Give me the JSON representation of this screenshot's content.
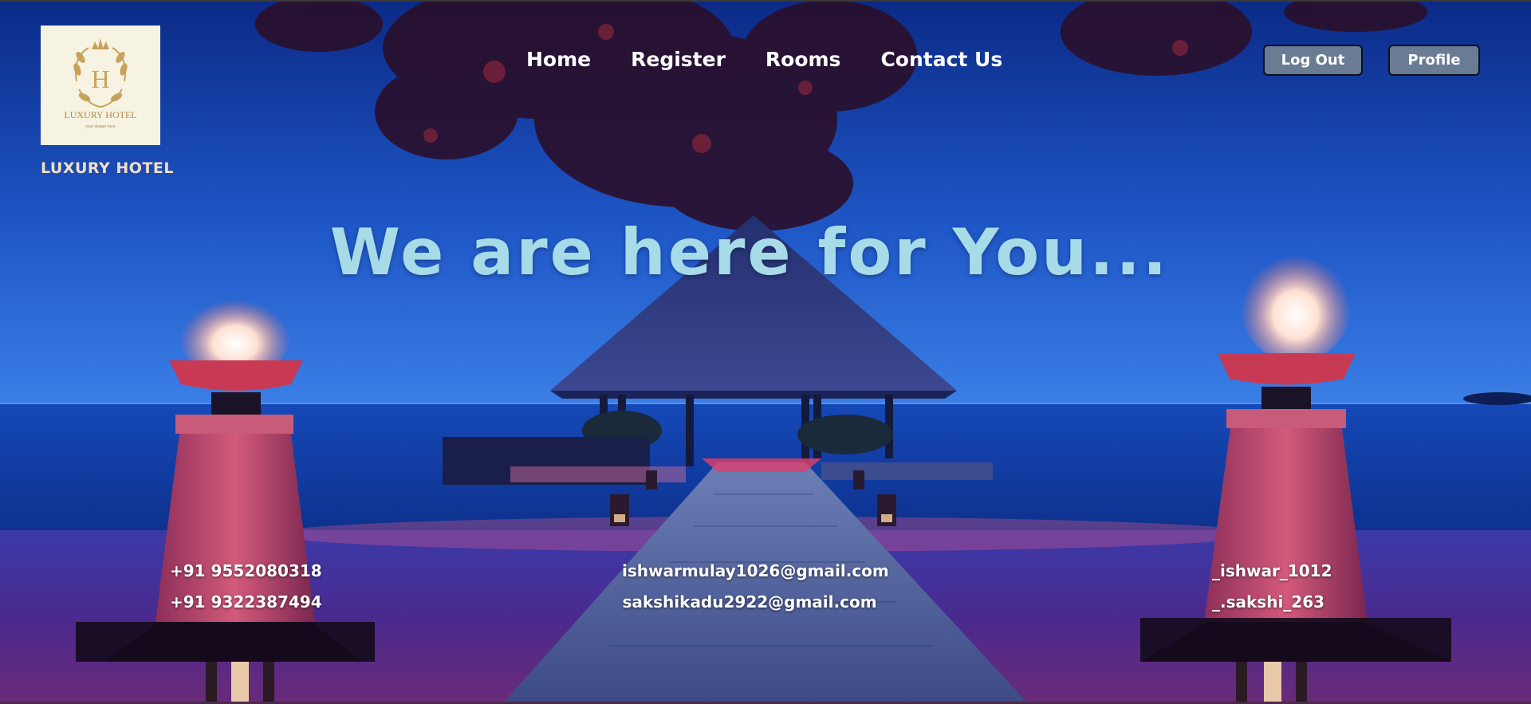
{
  "brand": {
    "logo_title": "LUXURY HOTEL",
    "logo_initial": "H",
    "logo_tagline": "your slogan here",
    "name": "LUXURY HOTEL"
  },
  "nav": {
    "items": [
      {
        "label": "Home"
      },
      {
        "label": "Register"
      },
      {
        "label": "Rooms"
      },
      {
        "label": "Contact Us"
      }
    ]
  },
  "actions": {
    "logout_label": "Log Out",
    "profile_label": "Profile"
  },
  "hero": {
    "headline": "We are here for You..."
  },
  "contacts": {
    "phones": [
      "+91 9552080318",
      "+91 9322387494"
    ],
    "emails": [
      "ishwarmulay1026@gmail.com",
      "sakshikadu2922@gmail.com"
    ],
    "socials": [
      "_ishwar_1012",
      "_.sakshi_263"
    ]
  },
  "colors": {
    "sky_top": "#0d2f8f",
    "sky_bottom": "#2a6ad8",
    "headline": "#a6dbe7",
    "button_bg": "#6a7c93",
    "brand_text": "#f3dfc0",
    "logo_gold": "#c8a25a"
  }
}
